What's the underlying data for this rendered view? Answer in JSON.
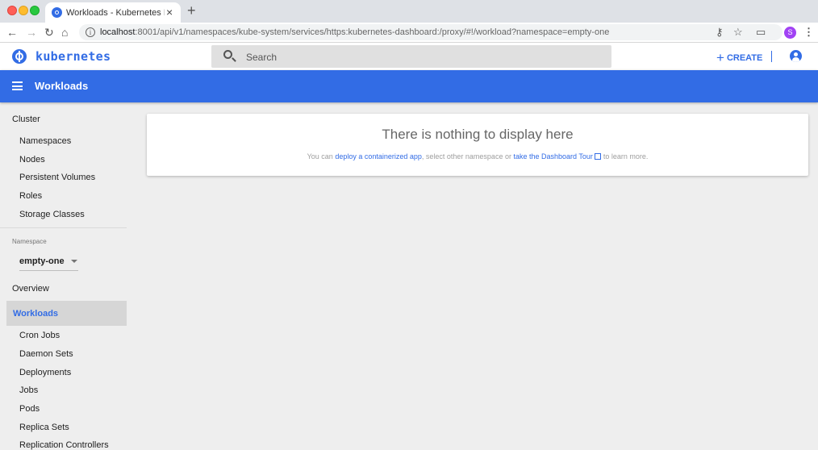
{
  "browser": {
    "tab_title": "Workloads - Kubernetes Dashb",
    "tab_close": "×",
    "new_tab": "+",
    "url_host": "localhost",
    "url_rest": ":8001/api/v1/namespaces/kube-system/services/https:kubernetes-dashboard:/proxy/#!/workload?namespace=empty-one",
    "profile_initial": "S",
    "icons": [
      "back-icon",
      "forward-icon",
      "reload-icon",
      "home-icon",
      "info-icon",
      "key-icon",
      "star-icon",
      "cast-icon",
      "menu-kebab-icon"
    ]
  },
  "header": {
    "brand": "kubernetes",
    "search_placeholder": "Search",
    "create_label": "CREATE"
  },
  "toolbar": {
    "title": "Workloads"
  },
  "sidebar": {
    "cluster_heading": "Cluster",
    "cluster_items": [
      "Namespaces",
      "Nodes",
      "Persistent Volumes",
      "Roles",
      "Storage Classes"
    ],
    "namespace_label": "Namespace",
    "namespace_value": "empty-one",
    "overview": "Overview",
    "workloads": "Workloads",
    "workload_items": [
      "Cron Jobs",
      "Daemon Sets",
      "Deployments",
      "Jobs",
      "Pods",
      "Replica Sets",
      "Replication Controllers"
    ]
  },
  "main": {
    "empty_title": "There is nothing to display here",
    "desc_prefix": "You can ",
    "desc_link1": "deploy a containerized app",
    "desc_middle": ", select other namespace or ",
    "desc_link2": "take the Dashboard Tour",
    "desc_suffix": "to learn more."
  },
  "colors": {
    "brand_blue": "#326ce5",
    "background": "#eeeeee",
    "active_item_bg": "#d6d6d6"
  }
}
